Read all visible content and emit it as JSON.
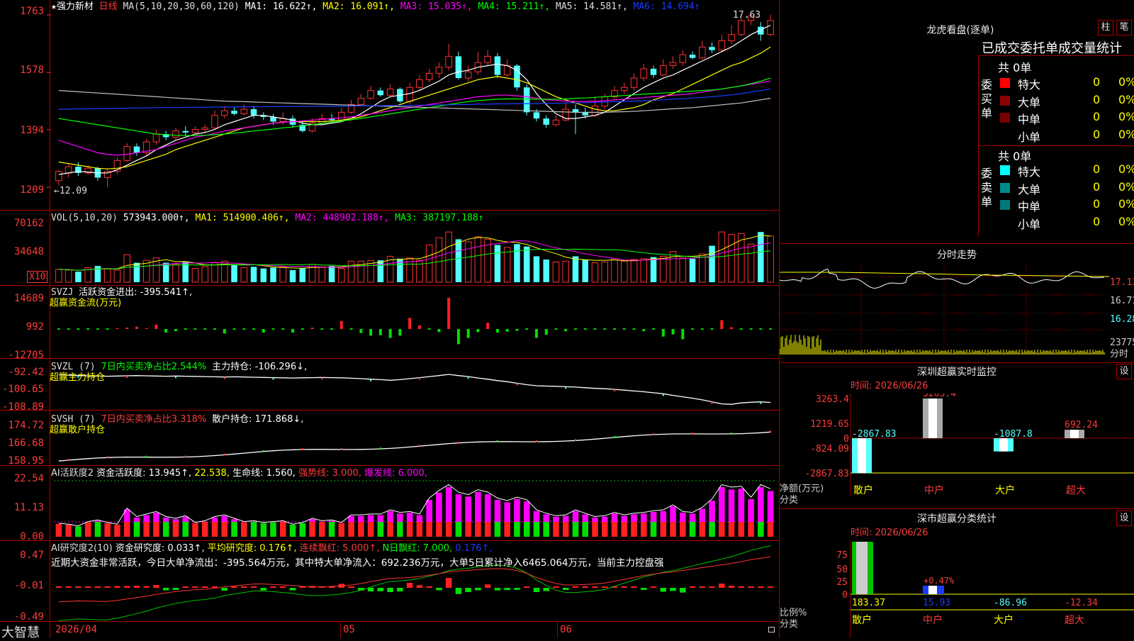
{
  "colors": {
    "up": "#ff3232",
    "down": "#54ffff",
    "ma1": "#ffffff",
    "ma2": "#ffff00",
    "ma3": "#ff00ff",
    "ma4": "#00ff00",
    "ma5": "#c0c0c0",
    "ma6": "#1a3cff",
    "grid": "#a00000"
  },
  "header": {
    "star": "★",
    "stock_name": "强力新材",
    "period": "日线",
    "ma_label": "MA(5,10,20,30,60,120)",
    "ma1": "MA1: 16.622↑,",
    "ma2": "MA2: 16.091↑,",
    "ma3": "MA3: 15.035↑,",
    "ma4": "MA4: 15.211↑,",
    "ma5": "MA5: 14.581↑,",
    "ma6": "MA6: 14.694↑"
  },
  "price_axis": [
    "1763",
    "1578",
    "1394",
    "1209"
  ],
  "price_high_label": "17.63",
  "price_low_label": "←12.09",
  "vol_pane": {
    "label": "VOL(5,10,20)",
    "value": "573943.000↑,",
    "ma1": "MA1: 514900.406↑,",
    "ma2": "MA2: 448902.188↑,",
    "ma3": "MA3: 387197.188↑",
    "axis": [
      "70162",
      "34648"
    ],
    "unit": "X10"
  },
  "svzj_pane": {
    "label": "SVZJ",
    "value": "活跃资金进出: -395.541↑,",
    "sub": "超赢资金流(万元)",
    "axis": [
      "14689",
      "992",
      "-12705"
    ]
  },
  "svzl_pane": {
    "label": "SVZL (7)",
    "green": "7日内买卖净占比2.544%",
    "value": "主力持仓: -106.296↓,",
    "sub": "超赢主力持仓",
    "axis": [
      "-92.42",
      "-100.65",
      "-108.89"
    ]
  },
  "svsh_pane": {
    "label": "SVSH (7)",
    "red": "7日内买卖净占比3.318%",
    "value": "散户持仓: 171.868↓,",
    "sub": "超赢散户持仓",
    "axis": [
      "174.72",
      "166.68",
      "158.95"
    ]
  },
  "ai_pane": {
    "label": "AI活跃度2",
    "v1": "资金活跃度: 13.945↑,",
    "v2": "22.538,",
    "v3": "生命线: 1.560,",
    "v4": "强势线: 3.000,",
    "v5": "爆发线: 6.000,",
    "axis": [
      "22.54",
      "11.13",
      "0.00"
    ]
  },
  "ai_research": {
    "label": "AI研究度2(10)",
    "v1": "资金研究度: 0.033↑,",
    "v2": "平均研究度: 0.176↑,",
    "v3": "连续飘红: 5.000↑,",
    "v4": "N日飘红: 7.000,",
    "v5": "0.176↑,",
    "summary": "近期大资金非常活跃，今日大单净流出：-395.564万元，其中特大单净流入：692.236万元，大单5日累计净入6465.064万元，当前主力控盘强",
    "axis": [
      "0.47",
      "-0.01",
      "-0.49"
    ]
  },
  "bottom": {
    "brand": "大智慧",
    "date_start": "2026/04",
    "m05": "05",
    "m06": "06"
  },
  "right_panel": {
    "title": "龙虎看盘(逐单)",
    "btn1": "柱",
    "btn2": "笔",
    "stats_title": "已成交委托单成交量统计",
    "buy_side": "委买单",
    "sell_side": "委卖单",
    "buy_total": "共 0单",
    "sell_total": "共 0单",
    "buy_rows": [
      {
        "name": "特大",
        "count": "0",
        "pct": "0%",
        "color": "#ff0000"
      },
      {
        "name": "大单",
        "count": "0",
        "pct": "0%",
        "color": "#8b0000"
      },
      {
        "name": "中单",
        "count": "0",
        "pct": "0%",
        "color": "#7a0000"
      },
      {
        "name": "小单",
        "count": "0",
        "pct": "0%",
        "color": ""
      }
    ],
    "sell_rows": [
      {
        "name": "特大",
        "count": "0",
        "pct": "0%",
        "color": "#00ffff"
      },
      {
        "name": "大单",
        "count": "0",
        "pct": "0%",
        "color": "#008b8b"
      },
      {
        "name": "中单",
        "count": "0",
        "pct": "0%",
        "color": "#007a7a"
      },
      {
        "name": "小单",
        "count": "0",
        "pct": "0%",
        "color": ""
      }
    ],
    "intraday_title": "分时走势",
    "intraday_axis": [
      "17.13",
      "16.71",
      "16.28",
      "23775",
      "分时"
    ],
    "monitor_title": "深圳超赢实时监控",
    "monitor_btn": "设",
    "monitor_time": "时间: 2026/06/26",
    "monitor_axis": [
      "3263.4",
      "1219.65",
      "0",
      "-824.09",
      "-2867.83"
    ],
    "monitor_ylabel": "净额(万元)",
    "monitor_xlabel": "分类",
    "monitor_cats": [
      "散户",
      "中户",
      "大户",
      "超大"
    ],
    "monitor_values": [
      -2867.83,
      3263.4,
      -1087.8,
      692.24
    ],
    "monitor_labels": [
      "-2867.83",
      "3263.4",
      "-1087.8",
      "692.24"
    ],
    "class_title": "深市超赢分类统计",
    "class_btn": "设",
    "class_time": "时间: 2026/06/26",
    "class_axis": [
      "75",
      "50",
      "25",
      "0"
    ],
    "class_ylabel": "比例%",
    "class_xlabel": "分类",
    "class_bar_label": "+0.47%",
    "class_values": [
      "183.37",
      "15.93",
      "-86.96",
      "-12.34"
    ],
    "class_cats": [
      "散户",
      "中户",
      "大户",
      "超大"
    ]
  },
  "chart_data": {
    "type": "candlestick",
    "candles": [
      [
        12.3,
        12.6,
        12.15,
        12.65
      ],
      [
        12.55,
        12.75,
        12.4,
        12.85
      ],
      [
        12.75,
        12.55,
        12.45,
        12.9
      ],
      [
        12.55,
        12.7,
        12.5,
        12.8
      ],
      [
        12.7,
        12.4,
        12.3,
        12.75
      ],
      [
        12.4,
        12.6,
        12.09,
        12.7
      ],
      [
        12.6,
        12.95,
        12.5,
        13.05
      ],
      [
        12.95,
        13.4,
        12.9,
        13.5
      ],
      [
        13.4,
        13.2,
        13.1,
        13.5
      ],
      [
        13.2,
        13.55,
        13.1,
        13.65
      ],
      [
        13.55,
        13.8,
        13.45,
        13.95
      ],
      [
        13.8,
        13.7,
        13.6,
        13.9
      ],
      [
        13.7,
        13.9,
        13.6,
        14.0
      ],
      [
        13.9,
        13.85,
        13.75,
        14.05
      ],
      [
        13.85,
        13.95,
        13.8,
        14.05
      ],
      [
        13.95,
        14.0,
        13.85,
        14.1
      ],
      [
        14.0,
        14.4,
        13.95,
        14.55
      ],
      [
        14.4,
        14.55,
        14.3,
        14.7
      ],
      [
        14.55,
        14.45,
        14.4,
        14.65
      ],
      [
        14.45,
        14.6,
        14.4,
        14.75
      ],
      [
        14.6,
        14.4,
        14.3,
        14.7
      ],
      [
        14.4,
        14.35,
        14.25,
        14.5
      ],
      [
        14.35,
        14.2,
        14.1,
        14.45
      ],
      [
        14.2,
        14.3,
        14.1,
        14.5
      ],
      [
        14.3,
        14.1,
        14.0,
        14.4
      ],
      [
        14.1,
        13.9,
        13.85,
        14.2
      ],
      [
        13.9,
        14.15,
        13.85,
        14.3
      ],
      [
        14.15,
        14.3,
        14.1,
        14.45
      ],
      [
        14.3,
        14.25,
        14.2,
        14.45
      ],
      [
        14.25,
        14.5,
        14.2,
        14.65
      ],
      [
        14.5,
        14.75,
        14.45,
        14.9
      ],
      [
        14.75,
        14.95,
        14.7,
        15.1
      ],
      [
        14.95,
        15.2,
        14.9,
        15.35
      ],
      [
        15.2,
        15.05,
        15.0,
        15.3
      ],
      [
        15.05,
        15.25,
        15.0,
        15.4
      ],
      [
        15.25,
        14.85,
        14.8,
        15.3
      ],
      [
        14.85,
        15.3,
        14.75,
        15.45
      ],
      [
        15.3,
        15.55,
        15.2,
        15.7
      ],
      [
        15.55,
        15.75,
        15.45,
        15.9
      ],
      [
        15.75,
        15.95,
        15.6,
        16.1
      ],
      [
        15.95,
        16.3,
        15.85,
        16.7
      ],
      [
        16.3,
        15.6,
        15.55,
        16.45
      ],
      [
        15.6,
        15.8,
        15.5,
        16.0
      ],
      [
        15.8,
        16.1,
        15.7,
        16.45
      ],
      [
        16.1,
        16.3,
        16.0,
        16.5
      ],
      [
        16.3,
        15.7,
        15.6,
        16.4
      ],
      [
        15.7,
        16.0,
        15.65,
        16.2
      ],
      [
        16.0,
        15.3,
        15.2,
        16.05
      ],
      [
        15.3,
        14.5,
        14.4,
        15.4
      ],
      [
        14.5,
        14.3,
        14.2,
        14.6
      ],
      [
        14.3,
        14.1,
        14.0,
        14.4
      ],
      [
        14.1,
        14.25,
        14.05,
        14.4
      ],
      [
        14.25,
        14.6,
        14.2,
        14.8
      ],
      [
        14.6,
        14.5,
        13.8,
        14.75
      ],
      [
        14.5,
        14.4,
        14.3,
        14.65
      ],
      [
        14.4,
        14.7,
        14.35,
        15.0
      ],
      [
        14.7,
        15.0,
        14.6,
        15.1
      ],
      [
        15.0,
        15.2,
        14.9,
        15.35
      ],
      [
        15.2,
        15.3,
        15.1,
        15.45
      ],
      [
        15.3,
        15.6,
        15.2,
        15.75
      ],
      [
        15.6,
        15.9,
        15.5,
        16.05
      ],
      [
        15.9,
        15.7,
        15.6,
        16.0
      ],
      [
        15.7,
        16.0,
        15.65,
        16.2
      ],
      [
        16.0,
        16.1,
        15.9,
        16.3
      ],
      [
        16.1,
        16.35,
        16.0,
        16.5
      ],
      [
        16.35,
        16.25,
        16.2,
        16.45
      ],
      [
        16.25,
        16.6,
        16.2,
        16.8
      ],
      [
        16.6,
        16.5,
        16.4,
        16.75
      ],
      [
        16.5,
        16.8,
        16.45,
        17.0
      ],
      [
        16.8,
        17.0,
        16.7,
        17.3
      ],
      [
        17.0,
        17.45,
        16.95,
        17.55
      ],
      [
        17.45,
        17.6,
        17.3,
        17.63
      ],
      [
        17.25,
        17.0,
        16.8,
        17.4
      ],
      [
        17.0,
        17.45,
        16.95,
        17.63
      ]
    ],
    "ma_series": {
      "ma1": [
        12.5,
        12.55,
        12.6,
        12.58,
        12.55,
        12.55,
        12.65,
        12.8,
        12.95,
        13.1,
        13.3,
        13.45,
        13.6,
        13.7,
        13.8,
        13.85,
        13.95,
        14.1,
        14.2,
        14.3,
        14.4,
        14.4,
        14.35,
        14.3,
        14.25,
        14.15,
        14.1,
        14.1,
        14.15,
        14.2,
        14.3,
        14.45,
        14.65,
        14.85,
        15.0,
        15.05,
        15.1,
        15.2,
        15.35,
        15.5,
        15.7,
        15.8,
        15.85,
        15.95,
        16.0,
        16.05,
        16.0,
        15.85,
        15.55,
        15.1,
        14.75,
        14.45,
        14.3,
        14.3,
        14.35,
        14.4,
        14.5,
        14.7,
        14.9,
        15.1,
        15.3,
        15.45,
        15.6,
        15.7,
        15.85,
        16.0,
        16.15,
        16.3,
        16.45,
        16.6,
        16.8,
        17.0,
        17.15,
        17.3
      ],
      "ma2": [
        12.9,
        12.85,
        12.8,
        12.75,
        12.7,
        12.68,
        12.7,
        12.75,
        12.85,
        12.95,
        13.05,
        13.15,
        13.3,
        13.4,
        13.5,
        13.6,
        13.7,
        13.8,
        13.9,
        14.0,
        14.05,
        14.1,
        14.15,
        14.18,
        14.2,
        14.2,
        14.2,
        14.2,
        14.22,
        14.25,
        14.3,
        14.35,
        14.45,
        14.55,
        14.65,
        14.75,
        14.85,
        14.95,
        15.05,
        15.15,
        15.25,
        15.35,
        15.45,
        15.55,
        15.6,
        15.65,
        15.6,
        15.55,
        15.45,
        15.3,
        15.15,
        15.0,
        14.9,
        14.8,
        14.7,
        14.6,
        14.55,
        14.55,
        14.6,
        14.65,
        14.75,
        14.9,
        15.0,
        15.1,
        15.25,
        15.4,
        15.55,
        15.7,
        15.85,
        16.0,
        16.1,
        16.25,
        16.4,
        16.6
      ],
      "ma3": [
        13.6,
        13.5,
        13.4,
        13.3,
        13.2,
        13.15,
        13.12,
        13.15,
        13.2,
        13.25,
        13.3,
        13.4,
        13.5,
        13.6,
        13.7,
        13.75,
        13.82,
        13.9,
        13.95,
        14.0,
        14.05,
        14.1,
        14.15,
        14.18,
        14.2,
        14.22,
        14.25,
        14.27,
        14.3,
        14.32,
        14.35,
        14.4,
        14.45,
        14.5,
        14.55,
        14.6,
        14.65,
        14.7,
        14.75,
        14.8,
        14.85,
        14.9,
        14.95,
        15.0,
        15.02,
        15.05,
        15.05,
        15.03,
        15.0,
        14.95,
        14.9,
        14.88,
        14.86,
        14.85,
        14.85,
        14.85,
        14.87,
        14.9,
        14.92,
        14.95,
        14.97,
        15.0,
        15.02,
        15.05,
        15.07,
        15.1,
        15.15,
        15.2,
        15.25,
        15.3,
        15.35,
        15.4,
        15.45,
        15.5
      ],
      "ma4": [
        14.3,
        14.25,
        14.2,
        14.15,
        14.1,
        14.05,
        14.0,
        13.95,
        13.9,
        13.85,
        13.8,
        13.78,
        13.76,
        13.75,
        13.75,
        13.76,
        13.78,
        13.8,
        13.83,
        13.86,
        13.9,
        13.93,
        13.96,
        14.0,
        14.03,
        14.07,
        14.1,
        14.14,
        14.18,
        14.22,
        14.26,
        14.3,
        14.35,
        14.4,
        14.45,
        14.5,
        14.55,
        14.6,
        14.65,
        14.7,
        14.75,
        14.8,
        14.84,
        14.88,
        14.9,
        14.92,
        14.93,
        14.93,
        14.93,
        14.92,
        14.92,
        14.92,
        14.93,
        14.95,
        14.96,
        14.98,
        15.0,
        15.02,
        15.04,
        15.06,
        15.08,
        15.1,
        15.12,
        15.14,
        15.16,
        15.18,
        15.2,
        15.22,
        15.25,
        15.3,
        15.35,
        15.42,
        15.5,
        15.6
      ],
      "ma5": [
        15.2,
        15.18,
        15.16,
        15.14,
        15.12,
        15.1,
        15.08,
        15.06,
        15.04,
        15.02,
        15.0,
        14.98,
        14.96,
        14.94,
        14.92,
        14.9,
        14.88,
        14.86,
        14.85,
        14.84,
        14.83,
        14.82,
        14.81,
        14.8,
        14.79,
        14.78,
        14.77,
        14.76,
        14.75,
        14.74,
        14.73,
        14.72,
        14.71,
        14.7,
        14.69,
        14.68,
        14.67,
        14.66,
        14.65,
        14.64,
        14.63,
        14.62,
        14.61,
        14.6,
        14.59,
        14.58,
        14.57,
        14.56,
        14.55,
        14.54,
        14.53,
        14.52,
        14.51,
        14.5,
        14.5,
        14.5,
        14.5,
        14.51,
        14.52,
        14.53,
        14.55,
        14.57,
        14.59,
        14.61,
        14.63,
        14.65,
        14.68,
        14.71,
        14.74,
        14.77,
        14.8,
        14.85,
        14.9,
        14.95
      ],
      "ma6": [
        14.6,
        14.6,
        14.61,
        14.61,
        14.62,
        14.62,
        14.63,
        14.63,
        14.64,
        14.64,
        14.65,
        14.65,
        14.65,
        14.66,
        14.66,
        14.66,
        14.67,
        14.67,
        14.67,
        14.68,
        14.68,
        14.68,
        14.68,
        14.69,
        14.69,
        14.69,
        14.69,
        14.7,
        14.7,
        14.7,
        14.7,
        14.71,
        14.71,
        14.71,
        14.72,
        14.72,
        14.72,
        14.73,
        14.73,
        14.74,
        14.74,
        14.75,
        14.75,
        14.76,
        14.76,
        14.77,
        14.77,
        14.78,
        14.78,
        14.78,
        14.79,
        14.79,
        14.8,
        14.8,
        14.81,
        14.82,
        14.83,
        14.84,
        14.85,
        14.86,
        14.87,
        14.88,
        14.9,
        14.92,
        14.94,
        14.96,
        14.98,
        15.0,
        15.03,
        15.06,
        15.1,
        15.15,
        15.2,
        15.25
      ]
    },
    "volume": [
      1600,
      1500,
      1300,
      1800,
      2000,
      1700,
      1500,
      3400,
      2400,
      2700,
      3000,
      2400,
      2200,
      2500,
      1700,
      1900,
      2400,
      2600,
      2200,
      1800,
      1900,
      1700,
      1800,
      1900,
      1500,
      1700,
      2200,
      1900,
      2000,
      1700,
      2600,
      2600,
      2700,
      2700,
      3200,
      2900,
      3000,
      2700,
      4600,
      5500,
      6200,
      5300,
      5000,
      5600,
      5300,
      4600,
      4300,
      4700,
      4400,
      3200,
      2800,
      2500,
      2600,
      3200,
      2800,
      2400,
      2500,
      2900,
      2600,
      2800,
      2900,
      3100,
      3200,
      3800,
      3000,
      2900,
      3500,
      4500,
      6200,
      5900,
      6000,
      4700,
      6200,
      5700
    ],
    "svzj": [
      0,
      0,
      0,
      0,
      0,
      0,
      200,
      300,
      500,
      200,
      1000,
      -800,
      -500,
      0,
      0,
      0,
      0,
      -1000,
      0,
      0,
      0,
      -800,
      0,
      0,
      -800,
      0,
      300,
      0,
      0,
      1800,
      0,
      -900,
      -1500,
      -1400,
      -2000,
      -1500,
      2500,
      800,
      0,
      -700,
      7000,
      -3400,
      -2000,
      -700,
      1400,
      -800,
      -600,
      -400,
      0,
      -2000,
      -1300,
      0,
      -500,
      0,
      0,
      0,
      0,
      0,
      0,
      0,
      -500,
      0,
      -1700,
      -1200,
      -2300,
      0,
      0,
      0,
      2000,
      400,
      0,
      0,
      0,
      0
    ],
    "svzl": [
      -92.6,
      -92.8,
      -93.0,
      -93.1,
      -93.2,
      -93.3,
      -93.2,
      -93.1,
      -93.0,
      -93.1,
      -93.2,
      -93.3,
      -93.2,
      -93.3,
      -93.4,
      -93.5,
      -93.6,
      -93.7,
      -93.6,
      -93.7,
      -93.8,
      -93.9,
      -94.0,
      -94.1,
      -94.2,
      -94.1,
      -94.0,
      -93.9,
      -94.0,
      -94.1,
      -94.3,
      -94.5,
      -94.8,
      -95.0,
      -95.3,
      -95.0,
      -94.5,
      -94.0,
      -93.5,
      -93.0,
      -92.4,
      -93.0,
      -93.5,
      -94.2,
      -94.8,
      -95.5,
      -96.0,
      -96.8,
      -97.5,
      -98.0,
      -98.2,
      -98.3,
      -98.5,
      -98.7,
      -99.0,
      -99.3,
      -99.5,
      -99.8,
      -100.2,
      -100.6,
      -101.0,
      -101.5,
      -102.0,
      -102.8,
      -103.5,
      -104.2,
      -105.0,
      -106.0,
      -107.0,
      -107.2,
      -106.5,
      -106.2,
      -106.0,
      -106.3
    ]
  }
}
